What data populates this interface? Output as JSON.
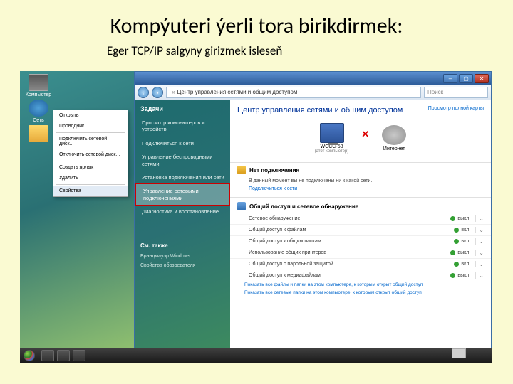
{
  "slide": {
    "title": "Kompýuteri ýerli tora birikdirmek:",
    "subtitle": "Eger TCP/IP salgyny girizmek isleseň"
  },
  "desktop": {
    "icons": [
      {
        "label": "Компьютер"
      },
      {
        "label": "Сеть"
      },
      {
        "label": ""
      }
    ]
  },
  "context_menu": {
    "items": [
      {
        "label": "Открыть",
        "selected": false
      },
      {
        "label": "Проводник",
        "selected": false
      },
      {
        "label": "Подключить сетевой диск...",
        "selected": false,
        "sep_before": true
      },
      {
        "label": "Отключить сетевой диск...",
        "selected": false
      },
      {
        "label": "Создать ярлык",
        "selected": false,
        "sep_before": true
      },
      {
        "label": "Удалить",
        "selected": false
      },
      {
        "label": "Свойства",
        "selected": true,
        "sep_before": true
      }
    ]
  },
  "window": {
    "addr_prefix": "«",
    "addr_text": "Центр управления сетями и общим доступом",
    "search_placeholder": "Поиск",
    "sidebar": {
      "header": "Задачи",
      "items": [
        {
          "label": "Просмотр компьютеров и устройств"
        },
        {
          "label": "Подключиться к сети"
        },
        {
          "label": "Управление беспроводными сетями"
        },
        {
          "label": "Установка подключения или сети"
        },
        {
          "label": "Управление сетевыми подключениями",
          "highlight": true
        },
        {
          "label": "Диагностика и восстановление"
        }
      ],
      "bottom_header": "См. также",
      "bottom_items": [
        {
          "label": "Брандмауэр Windows"
        },
        {
          "label": "Свойства обозревателя"
        }
      ]
    },
    "main": {
      "title": "Центр управления сетями и общим доступом",
      "map_link": "Просмотр полной карты",
      "diagram": {
        "node1_name": "WCCC-58",
        "node1_sub": "(этот компьютер)",
        "node2_name": "Интернет"
      },
      "status": {
        "header": "Нет подключения",
        "note": "В данный момент вы не подключены ни к какой сети.",
        "link": "Подключиться к сети"
      },
      "section": {
        "header": "Общий доступ и сетевое обнаружение",
        "rows": [
          {
            "label": "Сетевое обнаружение",
            "value": "выкл."
          },
          {
            "label": "Общий доступ к файлам",
            "value": "вкл."
          },
          {
            "label": "Общий доступ к общим папкам",
            "value": "вкл."
          },
          {
            "label": "Использование общих принтеров",
            "value": "выкл."
          },
          {
            "label": "Общий доступ с парольной защитой",
            "value": "вкл."
          },
          {
            "label": "Общий доступ к медиафайлам",
            "value": "выкл."
          }
        ]
      },
      "footer": {
        "line1": "Показать все файлы и папки на этом компьютере, к которым открыт общий доступ",
        "line2": "Показать все сетевые папки на этом компьютере, к которым открыт общий доступ"
      }
    }
  }
}
